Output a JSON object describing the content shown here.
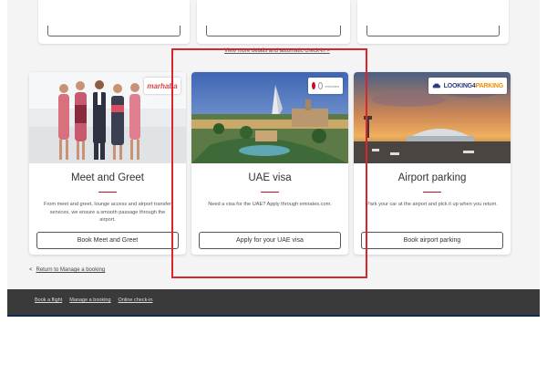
{
  "top": {
    "link_text": "View more details and automatic check-in >"
  },
  "cards": [
    {
      "title": "Meet and Greet",
      "description": "From meet and greet, lounge access and airport transfer services, we ensure a smooth passage through the airport.",
      "button_label": "Book Meet and Greet",
      "badge_text": "marhaba",
      "image_icon": "meet-and-greet-staff-photo"
    },
    {
      "title": "UAE visa",
      "description": "Need a visa for the UAE? Apply through emirates.com.",
      "button_label": "Apply for your UAE visa",
      "badge_text": "emirates",
      "image_icon": "dubai-burj-al-arab-photo"
    },
    {
      "title": "Airport parking",
      "description": "Park your car at the airport and pick it up when you return.",
      "button_label": "Book airport parking",
      "badge_text_part1": "LOOKING4",
      "badge_text_part2": "PARKING",
      "image_icon": "airport-sunset-photo"
    }
  ],
  "return_link": {
    "arrow": "<",
    "label": "Return to Manage a booking"
  },
  "footer": {
    "links": [
      "Book a flight",
      "Manage a booking",
      "Online check-in"
    ]
  },
  "colors": {
    "accent_red": "#c60c30",
    "highlight_red": "#d9262c",
    "footer_bg": "#3a3a3a",
    "page_bg": "#f4f4f4"
  }
}
